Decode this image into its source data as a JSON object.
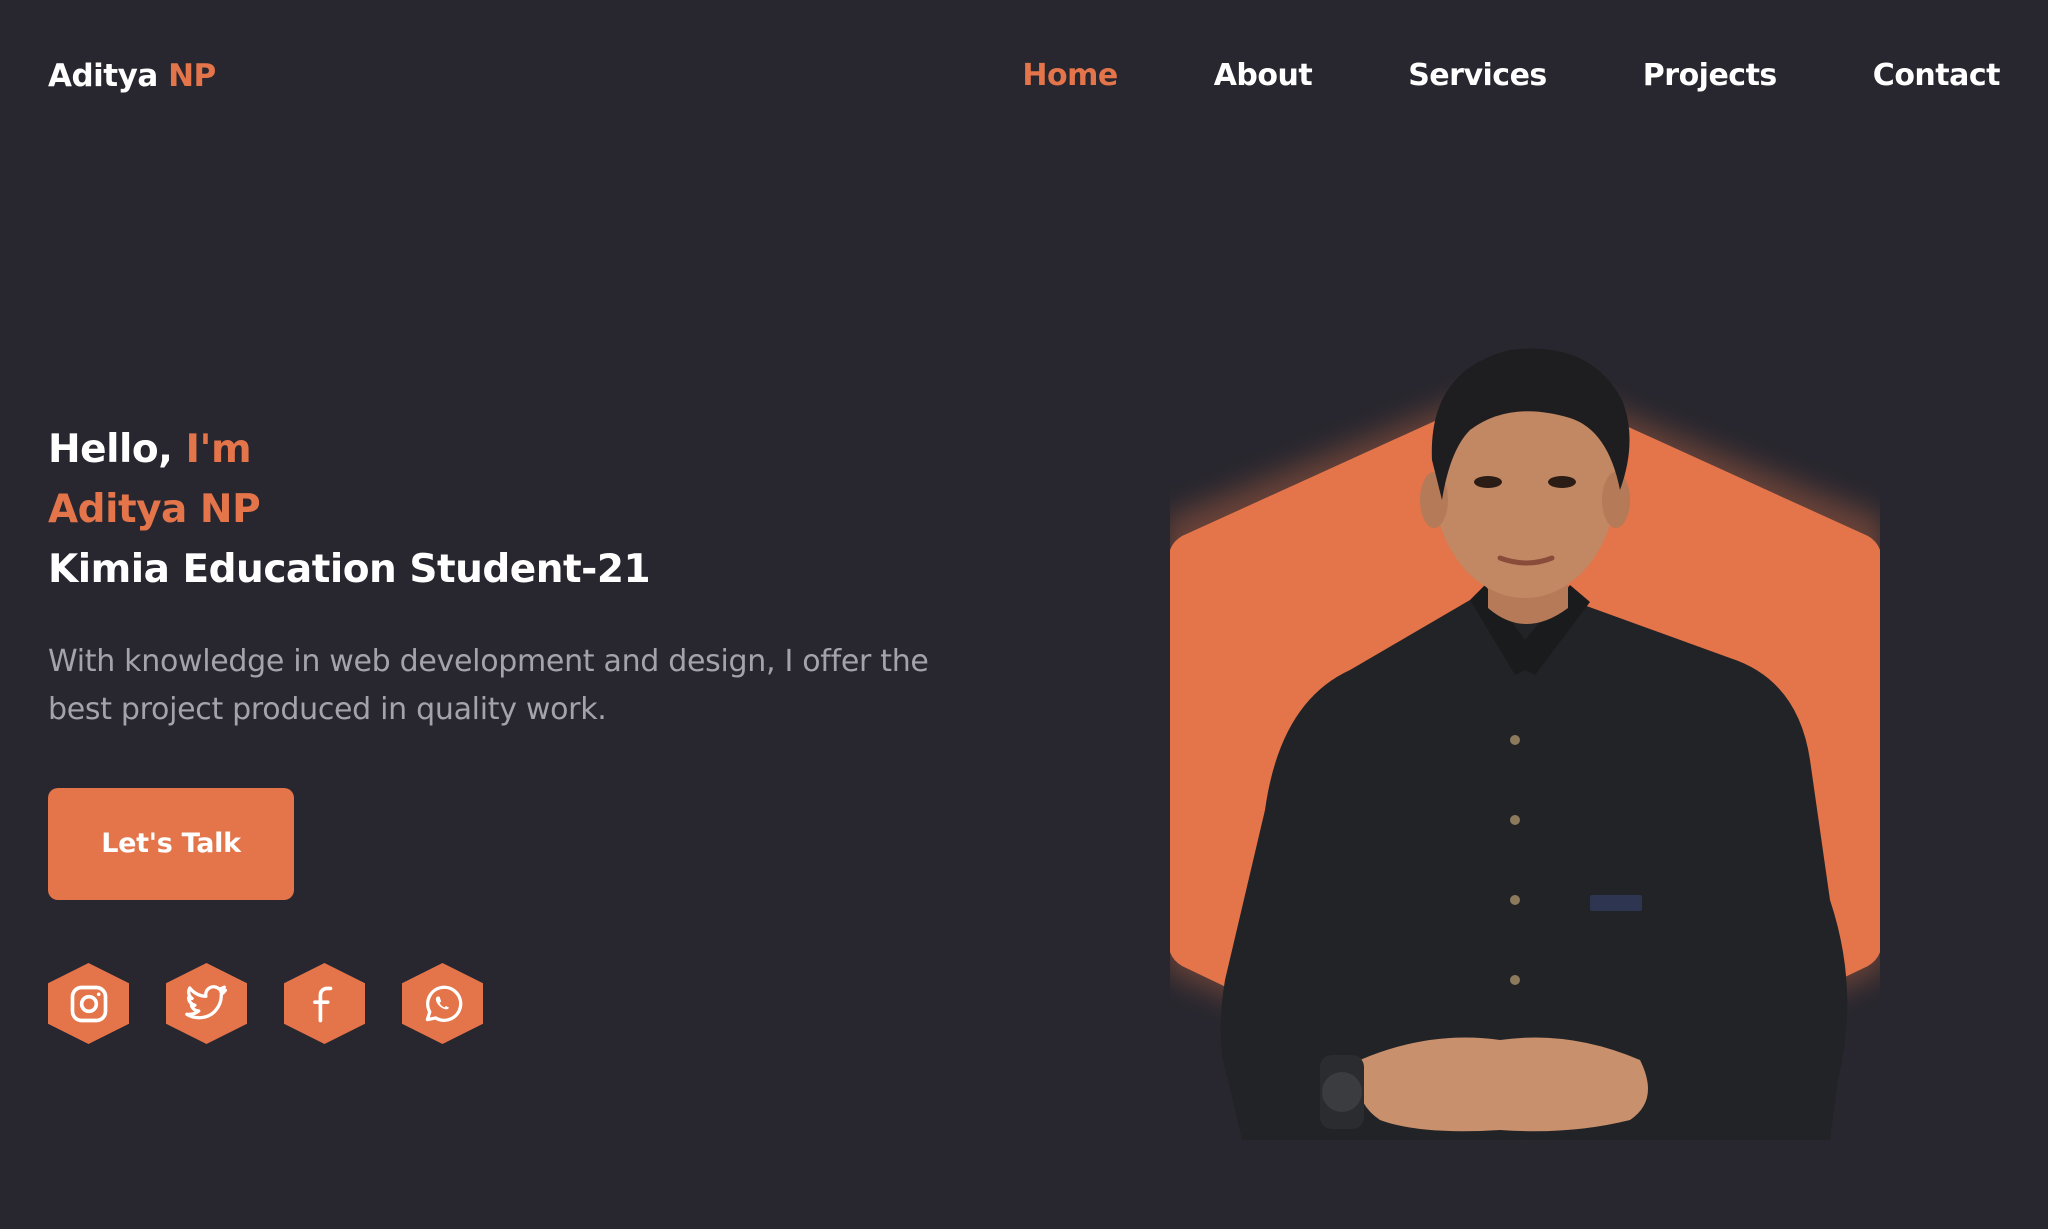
{
  "header": {
    "logo_first": "Aditya",
    "logo_second": "NP",
    "nav": [
      {
        "label": "Home",
        "active": true
      },
      {
        "label": "About"
      },
      {
        "label": "Services"
      },
      {
        "label": "Projects"
      },
      {
        "label": "Contact"
      }
    ]
  },
  "hero": {
    "greeting_prefix": "Hello,",
    "greeting_accent": "I'm",
    "name": "Aditya NP",
    "role": "Kimia Education Student-21",
    "description": "With knowledge in web development and design, I offer the best project produced in quality work.",
    "cta_label": "Let's Talk"
  },
  "socials": [
    {
      "icon": "instagram-icon"
    },
    {
      "icon": "twitter-icon"
    },
    {
      "icon": "facebook-icon"
    },
    {
      "icon": "whatsapp-icon"
    }
  ],
  "colors": {
    "background": "#28272f",
    "accent": "#e4744a",
    "text": "#ffffff",
    "muted": "#a4a3ad"
  }
}
